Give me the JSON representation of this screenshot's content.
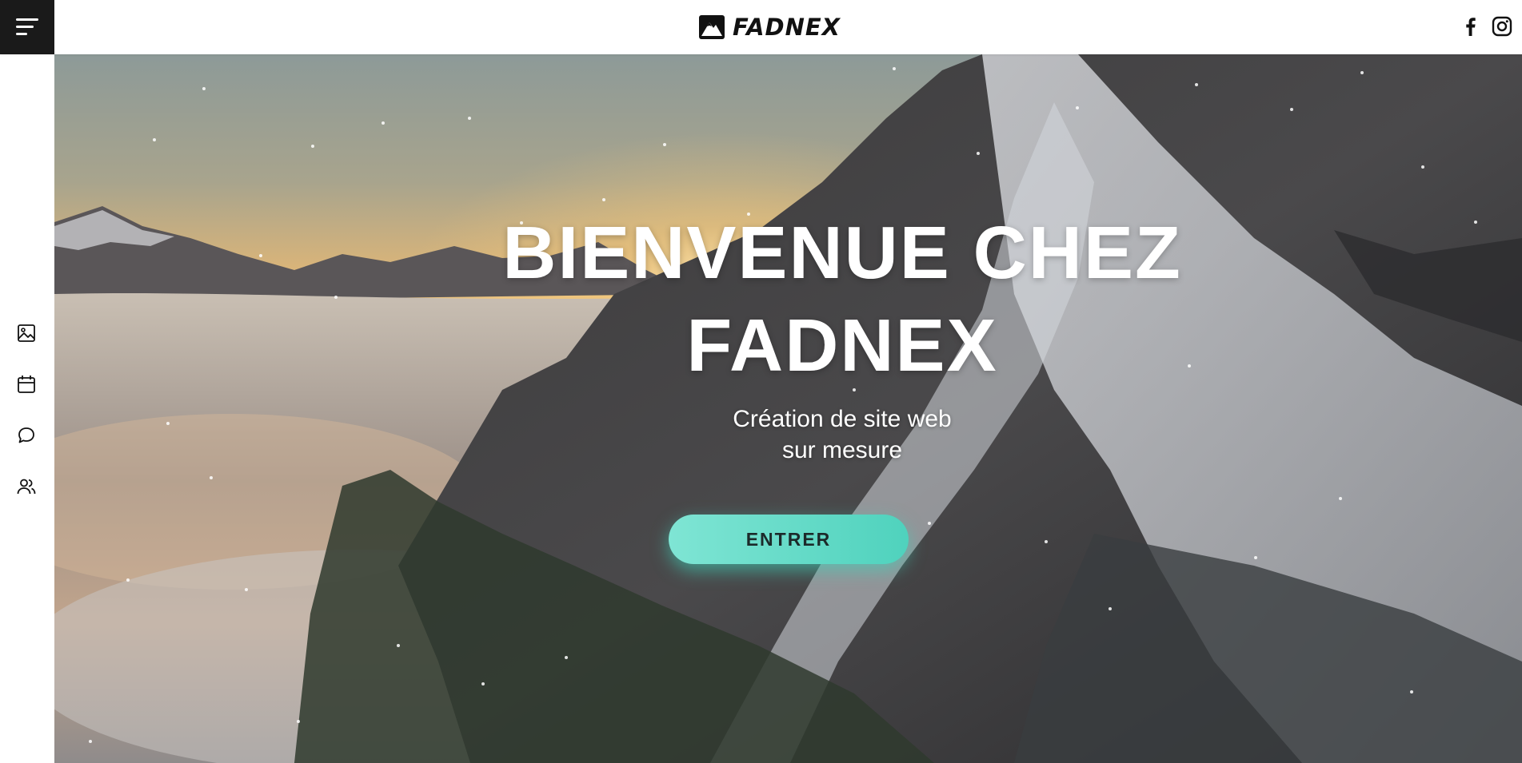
{
  "header": {
    "brand": "FADNEX",
    "menu_icon": "hamburger-menu-icon",
    "logo_icon": "mountain-logo-icon",
    "social": [
      {
        "name": "facebook-icon"
      },
      {
        "name": "instagram-icon"
      }
    ]
  },
  "sidebar": {
    "items": [
      {
        "icon": "image-icon"
      },
      {
        "icon": "calendar-icon"
      },
      {
        "icon": "chat-bubble-icon"
      },
      {
        "icon": "users-icon"
      }
    ]
  },
  "hero": {
    "title_line1": "BIENVENUE CHEZ",
    "title_line2": "FADNEX",
    "subtitle_line1": "Création de site web",
    "subtitle_line2": "sur mesure",
    "cta_label": "ENTRER",
    "background": "snowy-mountain-sunset-image"
  },
  "colors": {
    "menu_bg": "#1a1a1a",
    "accent": "#5fd9c4",
    "text_light": "#ffffff"
  }
}
